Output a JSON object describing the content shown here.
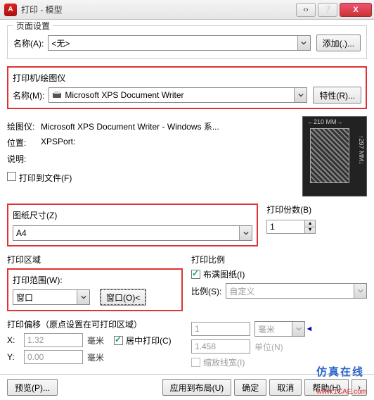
{
  "titlebar": {
    "title": "打印 - 模型",
    "close": "X"
  },
  "page_setup": {
    "title": "页面设置",
    "name_label": "名称(A):",
    "name_value": "<无>",
    "add_button": "添加(.)..."
  },
  "printer": {
    "title": "打印机/绘图仪",
    "name_label": "名称(M):",
    "name_value": "Microsoft XPS Document Writer",
    "props_button": "特性(R)...",
    "plotter_label": "绘图仪:",
    "plotter_value": "Microsoft XPS Document Writer - Windows 系...",
    "loc_label": "位置:",
    "loc_value": "XPSPort:",
    "desc_label": "说明:",
    "desc_value": "",
    "to_file_label": "打印到文件(F)",
    "thumb_width": "210 MM",
    "thumb_height": "297 MM"
  },
  "paper": {
    "title": "图纸尺寸(Z)",
    "value": "A4"
  },
  "copies": {
    "title": "打印份数(B)",
    "value": "1"
  },
  "area": {
    "title": "打印区域",
    "range_label": "打印范围(W):",
    "range_value": "窗口",
    "window_button": "窗口(O)<"
  },
  "scale": {
    "title": "打印比例",
    "fit_label": "布满图纸(I)",
    "ratio_label": "比例(S):",
    "ratio_value": "自定义",
    "num1": "1",
    "unit1": "毫米",
    "num2": "1.458",
    "unit2": "单位(N)",
    "linewt_label": "缩放线宽(I)"
  },
  "offset": {
    "title": "打印偏移（原点设置在可打印区域）",
    "x_label": "X:",
    "x_value": "1.32",
    "x_unit": "毫米",
    "y_label": "Y:",
    "y_value": "0.00",
    "y_unit": "毫米",
    "center_label": "居中打印(C)"
  },
  "footer": {
    "preview": "预览(P)...",
    "apply": "应用到布局(U)",
    "ok": "确定",
    "cancel": "取消",
    "help": "帮助(H)"
  },
  "watermark": "仿真在线",
  "sitemark": "www.1CAE.com"
}
